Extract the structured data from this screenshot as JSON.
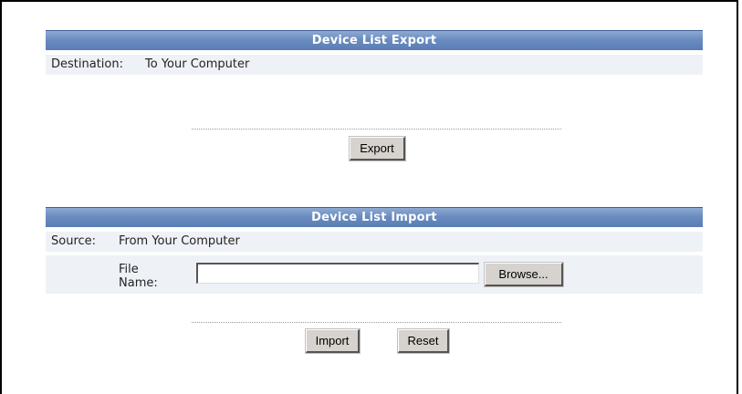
{
  "export": {
    "header": "Device List Export",
    "destination_label": "Destination:",
    "destination_value": "To Your Computer",
    "export_button": "Export"
  },
  "import": {
    "header": "Device List Import",
    "source_label": "Source:",
    "source_value": "From Your Computer",
    "file_name_label": "File Name:",
    "file_name_value": "",
    "browse_button": "Browse...",
    "import_button": "Import",
    "reset_button": "Reset"
  }
}
